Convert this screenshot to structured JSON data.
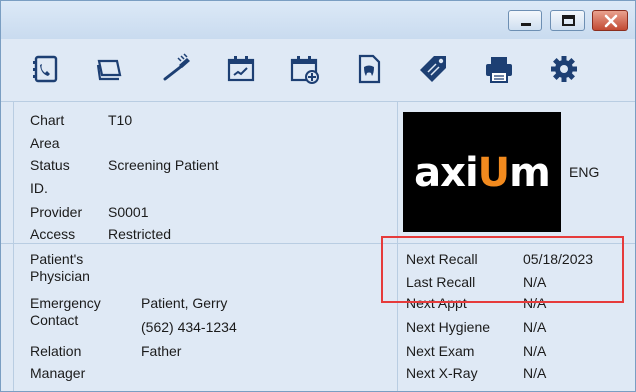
{
  "window": {
    "controls": {
      "minimize_icon": "minimize-icon",
      "maximize_icon": "maximize-icon",
      "close_icon": "close-icon"
    }
  },
  "toolbar": {
    "icons": [
      "phone-book-icon",
      "card-stack-icon",
      "toothbrush-icon",
      "calendar-edit-icon",
      "calendar-add-icon",
      "dental-document-icon",
      "tag-icon",
      "printer-icon",
      "gear-icon"
    ]
  },
  "chart": {
    "chart_label": "Chart",
    "chart_value": "T10",
    "area_label": "Area",
    "area_value": "",
    "status_label": "Status",
    "status_value": "Screening Patient",
    "id_label": "ID.",
    "id_value": "",
    "provider_label": "Provider",
    "provider_value": "S0001",
    "access_label": "Access",
    "access_value": "Restricted"
  },
  "logo": {
    "brand_text_pre": "axi",
    "brand_text_accent": "U",
    "brand_text_post": "m",
    "language": "ENG",
    "accent_color": "#f28a1e"
  },
  "contacts": {
    "physician_label_line1": "Patient's",
    "physician_label_line2": "Physician",
    "emergency_label_line1": "Emergency",
    "emergency_label_line2": "Contact",
    "emergency_name": "Patient, Gerry",
    "emergency_phone": "(562) 434-1234",
    "relation_label": "Relation",
    "relation_value": "Father",
    "manager_label": "Manager"
  },
  "recalls": {
    "next_recall_label": "Next Recall",
    "next_recall_value": "05/18/2023",
    "last_recall_label": "Last Recall",
    "last_recall_value": "N/A",
    "next_appt_label": "Next Appt",
    "next_appt_value": "N/A",
    "next_hygiene_label": "Next Hygiene",
    "next_hygiene_value": "N/A",
    "next_exam_label": "Next Exam",
    "next_exam_value": "N/A",
    "next_xray_label": "Next X-Ray",
    "next_xray_value": "N/A"
  },
  "highlight_color": "#e63b3b"
}
